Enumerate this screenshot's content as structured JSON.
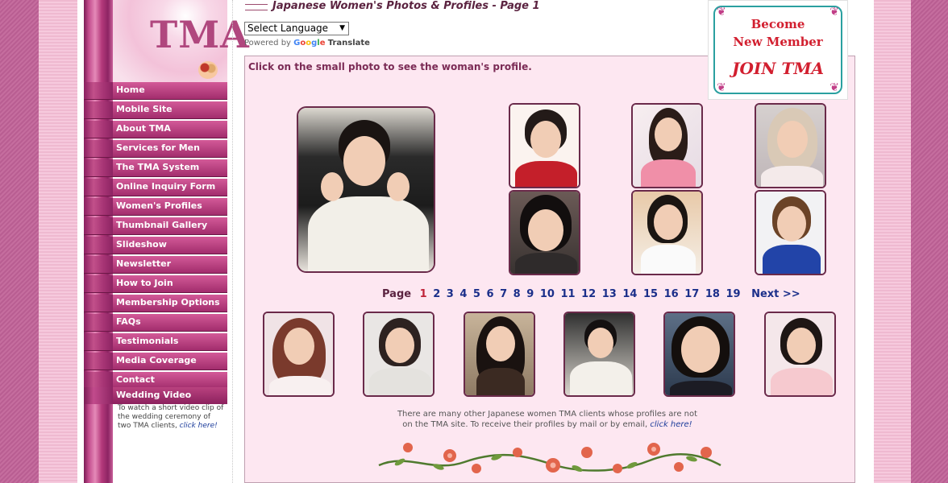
{
  "header": {
    "title": "Japanese Women's Photos & Profiles - Page 1"
  },
  "logo": {
    "text": "TMA"
  },
  "translate": {
    "select_label": "Select Language",
    "powered_by": "Powered by",
    "google": "Google",
    "translate": "Translate"
  },
  "sidebar": {
    "items": [
      {
        "label": "Home"
      },
      {
        "label": "Mobile Site"
      },
      {
        "label": "About TMA"
      },
      {
        "label": "Services for Men"
      },
      {
        "label": "The TMA System"
      },
      {
        "label": "Online Inquiry Form"
      },
      {
        "label": "Women's Profiles"
      },
      {
        "label": "Thumbnail Gallery"
      },
      {
        "label": "Slideshow"
      },
      {
        "label": "Newsletter"
      },
      {
        "label": "How to Join"
      },
      {
        "label": "Membership Options"
      },
      {
        "label": "FAQs"
      },
      {
        "label": "Testimonials"
      },
      {
        "label": "Media Coverage"
      },
      {
        "label": "Contact"
      }
    ],
    "wedding": {
      "title": "Wedding Video",
      "text": "To watch a short video clip of the wedding ceremony of two TMA clients, ",
      "link": "click here!"
    }
  },
  "main": {
    "instruction": "Click on the small photo to see the woman's profile.",
    "pager": {
      "label": "Page",
      "current": "1",
      "pages": [
        "2",
        "3",
        "4",
        "5",
        "6",
        "7",
        "8",
        "9",
        "10",
        "11",
        "12",
        "13",
        "14",
        "15",
        "16",
        "17",
        "18",
        "19"
      ],
      "next": "Next >>"
    },
    "footer_text": "There are many other Japanese women TMA clients whose profiles are not on the TMA site. To receive their profiles by mail or by email, ",
    "footer_link": "click here!"
  },
  "banner": {
    "line1": "Become",
    "line2": "New Member",
    "line3": "JOIN TMA"
  },
  "colors": {
    "accent": "#b0477e",
    "nav": "#a22d6d",
    "content_bg": "#fde7f1",
    "link": "#1b2f8a"
  }
}
